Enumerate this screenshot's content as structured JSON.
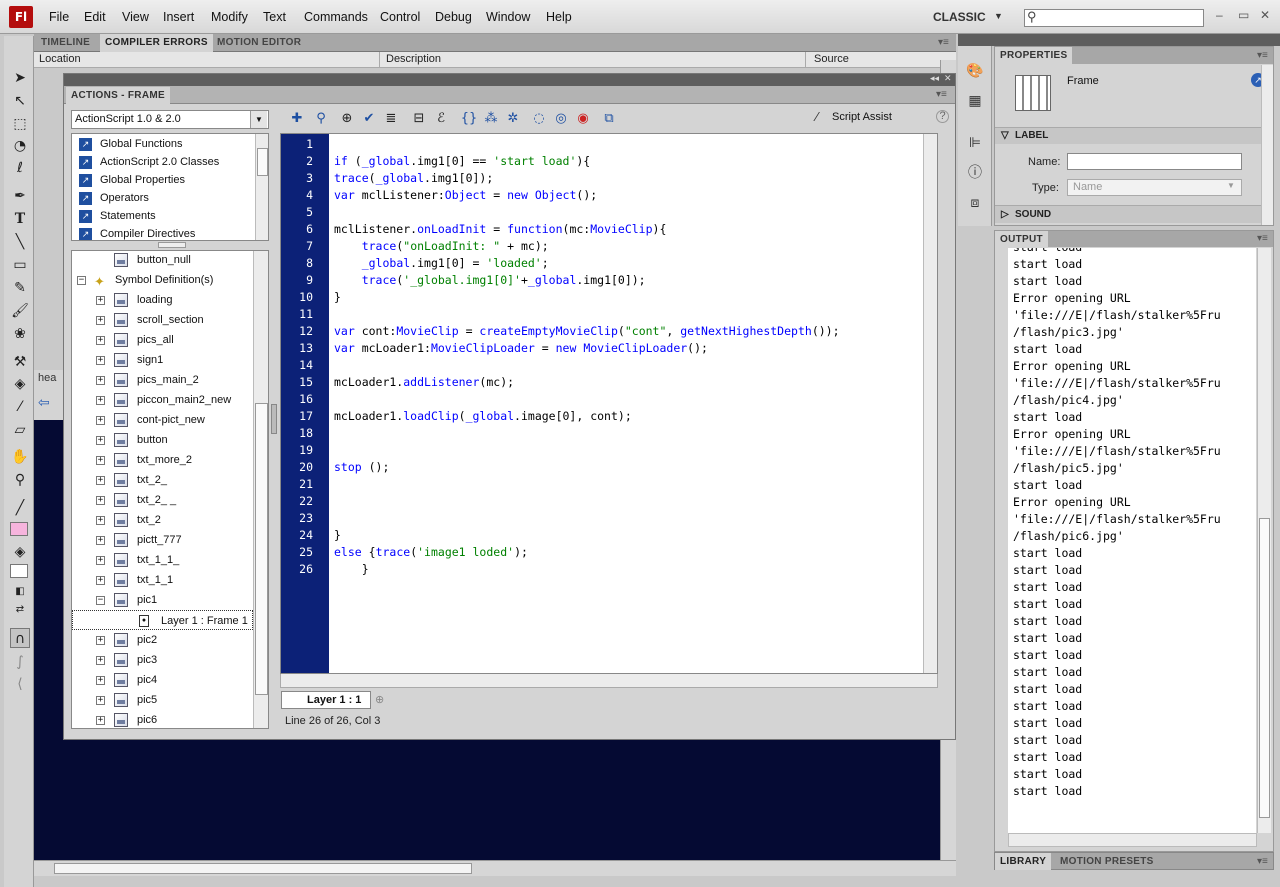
{
  "app": {
    "logo": "Fl",
    "workspace": "CLASSIC"
  },
  "menu": [
    "File",
    "Edit",
    "View",
    "Insert",
    "Modify",
    "Text",
    "Commands",
    "Control",
    "Debug",
    "Window",
    "Help"
  ],
  "top_tabs": [
    "TIMELINE",
    "COMPILER ERRORS",
    "MOTION EDITOR"
  ],
  "errors_columns": [
    "Location",
    "Description",
    "Source"
  ],
  "actions": {
    "title": "ACTIONS - FRAME",
    "language": "ActionScript 1.0 & 2.0",
    "categories": [
      "Global Functions",
      "ActionScript 2.0 Classes",
      "Global Properties",
      "Operators",
      "Statements",
      "Compiler Directives"
    ],
    "tree": [
      {
        "label": "button_null",
        "indent": 2,
        "expander": ""
      },
      {
        "label": "Symbol Definition(s)",
        "indent": 1,
        "expander": "−",
        "folder": true
      },
      {
        "label": "loading",
        "indent": 2,
        "expander": "+"
      },
      {
        "label": "scroll_section",
        "indent": 2,
        "expander": "+"
      },
      {
        "label": "pics_all",
        "indent": 2,
        "expander": "+"
      },
      {
        "label": "sign1",
        "indent": 2,
        "expander": "+"
      },
      {
        "label": "pics_main_2",
        "indent": 2,
        "expander": "+"
      },
      {
        "label": "piccon_main2_new",
        "indent": 2,
        "expander": "+"
      },
      {
        "label": "cont-pict_new",
        "indent": 2,
        "expander": "+"
      },
      {
        "label": "button",
        "indent": 2,
        "expander": "+"
      },
      {
        "label": "txt_more_2",
        "indent": 2,
        "expander": "+"
      },
      {
        "label": "txt_2_",
        "indent": 2,
        "expander": "+"
      },
      {
        "label": "txt_2_ _",
        "indent": 2,
        "expander": "+"
      },
      {
        "label": "txt_2",
        "indent": 2,
        "expander": "+"
      },
      {
        "label": "pictt_777",
        "indent": 2,
        "expander": "+"
      },
      {
        "label": "txt_1_1_",
        "indent": 2,
        "expander": "+"
      },
      {
        "label": "txt_1_1",
        "indent": 2,
        "expander": "+"
      },
      {
        "label": "pic1",
        "indent": 2,
        "expander": "−"
      },
      {
        "label": "Layer 1 : Frame 1",
        "indent": 3,
        "expander": "",
        "selected": true
      },
      {
        "label": "pic2",
        "indent": 2,
        "expander": "+"
      },
      {
        "label": "pic3",
        "indent": 2,
        "expander": "+"
      },
      {
        "label": "pic4",
        "indent": 2,
        "expander": "+"
      },
      {
        "label": "pic5",
        "indent": 2,
        "expander": "+"
      },
      {
        "label": "pic6",
        "indent": 2,
        "expander": "+"
      }
    ],
    "script_assist": "Script Assist",
    "help": "?",
    "code": [
      "",
      "if (_global.img1[0] == 'start load'){",
      "trace(_global.img1[0]);",
      "var mclListener:Object = new Object();",
      "",
      "mclListener.onLoadInit = function(mc:MovieClip){",
      "    trace(\"onLoadInit: \" + mc);",
      "    _global.img1[0] = 'loaded';",
      "    trace('_global.img1[0]'+_global.img1[0]);",
      "}",
      "",
      "var cont:MovieClip = createEmptyMovieClip(\"cont\", getNextHighestDepth());",
      "var mcLoader1:MovieClipLoader = new MovieClipLoader();",
      "",
      "mcLoader1.addListener(mc);",
      "",
      "mcLoader1.loadClip(_global.image[0], cont);",
      "",
      "",
      "stop ();",
      "",
      "",
      "",
      "}",
      "else {trace('image1 loded');",
      "    }"
    ],
    "layer_tab": "Layer 1 : 1",
    "status": "Line 26 of 26, Col 3"
  },
  "stage_tab": "hea",
  "properties": {
    "tab": "PROPERTIES",
    "kind": "Frame",
    "label_section": "LABEL",
    "name_label": "Name:",
    "name_value": "",
    "type_label": "Type:",
    "type_value": "Name",
    "sound_section": "SOUND"
  },
  "output": {
    "tab": "OUTPUT",
    "lines": [
      "start load",
      "start load",
      "start load",
      "Error opening URL",
      "'file:///E|/flash/stalker%5Fru",
      "/flash/pic3.jpg'",
      "start load",
      "Error opening URL",
      "'file:///E|/flash/stalker%5Fru",
      "/flash/pic4.jpg'",
      "start load",
      "Error opening URL",
      "'file:///E|/flash/stalker%5Fru",
      "/flash/pic5.jpg'",
      "start load",
      "Error opening URL",
      "'file:///E|/flash/stalker%5Fru",
      "/flash/pic6.jpg'",
      "start load",
      "start load",
      "start load",
      "start load",
      "start load",
      "start load",
      "start load",
      "start load",
      "start load",
      "start load",
      "start load",
      "start load",
      "start load",
      "start load",
      "start load"
    ]
  },
  "bottom_tabs": [
    "LIBRARY",
    "MOTION PRESETS"
  ]
}
